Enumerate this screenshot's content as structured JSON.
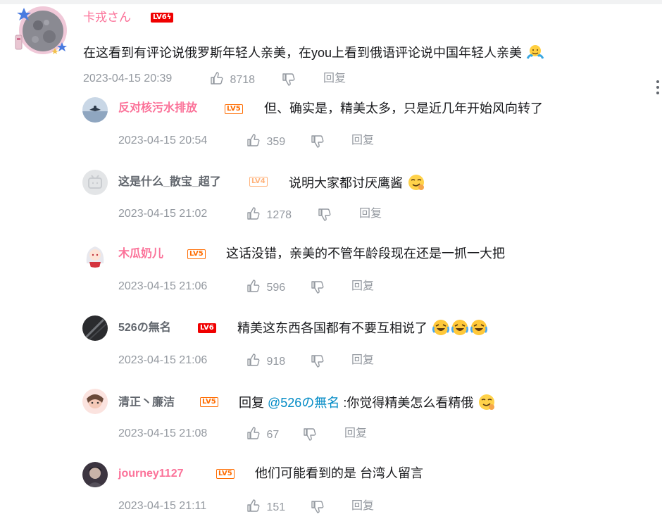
{
  "main_comment": {
    "username": "卡戎さん",
    "level_badge": "LV6",
    "level_flash": "ϟ",
    "text": "在这看到有评论说俄罗斯年轻人亲美，在you上看到俄语评论说中国年轻人亲美",
    "emoji": "shrug-emoji",
    "time": "2023-04-15 20:39",
    "likes": "8718",
    "reply_label": "回复"
  },
  "replies": [
    {
      "username": "反对核污水排放",
      "name_color": "#fb7299",
      "level": "LV5",
      "level_color": "#ff6c00",
      "text": "但、确实是，精美太多，只是近几年开始风向转了",
      "time": "2023-04-15 20:54",
      "likes": "359",
      "reply_label": "回复"
    },
    {
      "username": "这是什么_散宝_超了",
      "name_color": "#61666d",
      "level": "LV4",
      "level_color": "#ffb37c",
      "text": "说明大家都讨厌鹰酱",
      "emoji": "smirk-emoji",
      "time": "2023-04-15 21:02",
      "likes": "1278",
      "reply_label": "回复"
    },
    {
      "username": "木瓜奶儿",
      "name_color": "#fb7299",
      "level": "LV5",
      "level_color": "#ff6c00",
      "text": "这话没错，亲美的不管年龄段现在还是一抓一大把",
      "time": "2023-04-15 21:06",
      "likes": "596",
      "reply_label": "回复"
    },
    {
      "username": "526の無名",
      "name_color": "#61666d",
      "level": "LV6",
      "level_color": "#f00000",
      "text": "精美这东西各国都有不要互相说了",
      "emoji": "laugh-cry-emoji",
      "time": "2023-04-15 21:06",
      "likes": "918",
      "reply_label": "回复"
    },
    {
      "username": "清正丶廉洁",
      "name_color": "#61666d",
      "level": "LV5",
      "level_color": "#ff6c00",
      "prefix": "回复 ",
      "mention": "@526の無名",
      "text": " :你觉得精美怎么看精俄",
      "emoji": "smirk-emoji",
      "time": "2023-04-15 21:08",
      "likes": "67",
      "reply_label": "回复"
    },
    {
      "username": "journey1127",
      "name_color": "#fb7299",
      "level": "LV5",
      "level_color": "#ff6c00",
      "text": "他们可能看到的是 台湾人留言",
      "time": "2023-04-15 21:11",
      "likes": "151",
      "reply_label": "回复"
    }
  ],
  "colors": {
    "vip_pink": "#fb7299",
    "meta_gray": "#9499a0",
    "text": "#18191c",
    "link_blue": "#008ac5"
  }
}
